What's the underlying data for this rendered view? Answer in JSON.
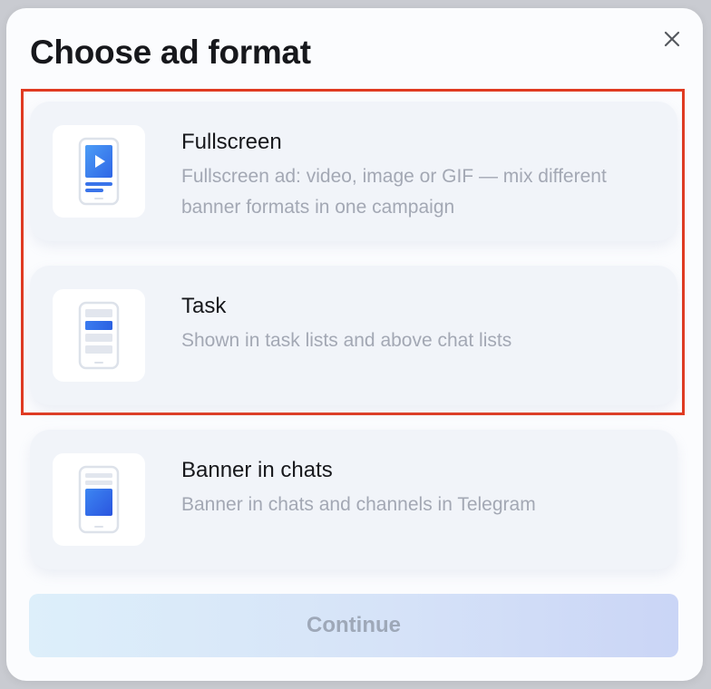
{
  "modal": {
    "title": "Choose ad format",
    "close_icon": "close-icon"
  },
  "formats": [
    {
      "title": "Fullscreen",
      "description": "Fullscreen ad: video, image or GIF — mix different banner formats in one campaign",
      "icon": "fullscreen-phone-icon"
    },
    {
      "title": "Task",
      "description": "Shown in task lists and above chat lists",
      "icon": "task-phone-icon"
    },
    {
      "title": "Banner in chats",
      "description": "Banner in chats and channels in Telegram",
      "icon": "banner-phone-icon"
    }
  ],
  "continue_label": "Continue",
  "colors": {
    "accent": "#3b82f6",
    "highlight": "#e03b22",
    "card_bg": "#f1f4f9"
  }
}
